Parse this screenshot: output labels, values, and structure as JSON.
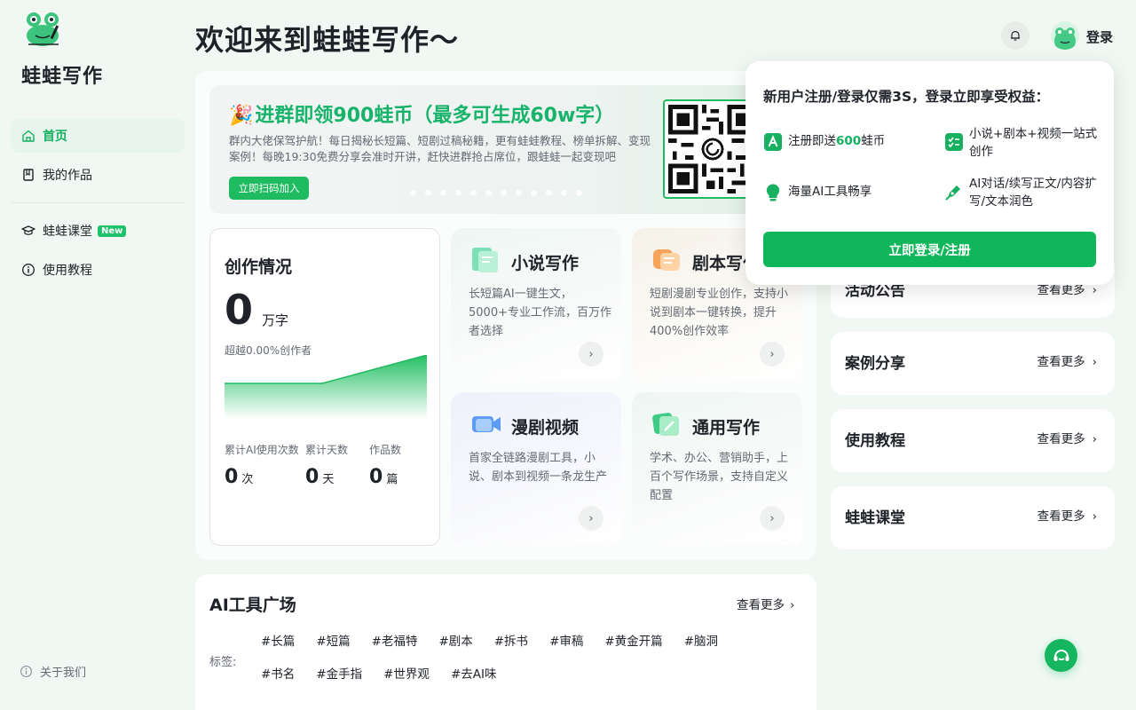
{
  "brand": {
    "name": "蛙蛙写作"
  },
  "sidebar": {
    "items": [
      {
        "label": "首页",
        "icon": "home-icon",
        "active": true
      },
      {
        "label": "我的作品",
        "icon": "book-icon"
      },
      {
        "label": "蛙蛙课堂",
        "icon": "graduation-cap-icon",
        "badge": "New"
      },
      {
        "label": "使用教程",
        "icon": "info-icon"
      }
    ],
    "about": "关于我们"
  },
  "header": {
    "welcome": "欢迎来到蛙蛙写作～",
    "login": "登录"
  },
  "banner": {
    "title": "进群即领900蛙币（最多可生成60w字）",
    "desc": "群内大佬保驾护航！每日揭秘长短篇、短剧过稿秘籍，更有蛙蛙教程、榜单拆解、变现案例！每晚19:30免费分享会准时开讲，赶快进群抢占席位，跟蛙蛙一起变现吧",
    "button": "立即扫码加入"
  },
  "stats": {
    "title": "创作情况",
    "words": "0",
    "words_unit": "万字",
    "percentile": "超越0.00%创作者",
    "items": [
      {
        "label": "累计AI使用次数",
        "value": "0",
        "unit": "次"
      },
      {
        "label": "累计天数",
        "value": "0",
        "unit": "天"
      },
      {
        "label": "作品数",
        "value": "0",
        "unit": "篇"
      }
    ]
  },
  "features": [
    {
      "name": "小说写作",
      "desc": "长短篇AI一键生文，5000+专业工作流，百万作者选择"
    },
    {
      "name": "剧本写作",
      "desc": "短剧漫剧专业创作，支持小说到剧本一键转换，提升400%创作效率"
    },
    {
      "name": "漫剧视频",
      "desc": "首家全链路漫剧工具，小说、剧本到视频一条龙生产"
    },
    {
      "name": "通用写作",
      "desc": "学术、办公、营销助手，上百个写作场景，支持自定义配置"
    }
  ],
  "tools": {
    "title": "AI工具广场",
    "more": "查看更多",
    "tags_label": "标签:",
    "tags": [
      "#长篇",
      "#短篇",
      "#老福特",
      "#剧本",
      "#拆书",
      "#审稿",
      "#黄金开篇",
      "#脑洞",
      "#书名",
      "#金手指",
      "#世界观",
      "#去AI味"
    ]
  },
  "side_cards": [
    {
      "title": "活动公告",
      "more": "查看更多"
    },
    {
      "title": "案例分享",
      "more": "查看更多"
    },
    {
      "title": "使用教程",
      "more": "查看更多"
    },
    {
      "title": "蛙蛙课堂",
      "more": "查看更多"
    }
  ],
  "popover": {
    "title": "新用户注册/登录仅需3S，登录立即享受权益：",
    "b1_pre": "注册即送",
    "b1_num": "600",
    "b1_post": "蛙币",
    "b2": "小说+剧本+视频一站式创作",
    "b3": "海量AI工具畅享",
    "b4": "AI对话/续写正文/内容扩写/文本润色",
    "button": "立即登录/注册"
  },
  "colors": {
    "accent": "#16b060",
    "background": "#f1f8f4"
  }
}
